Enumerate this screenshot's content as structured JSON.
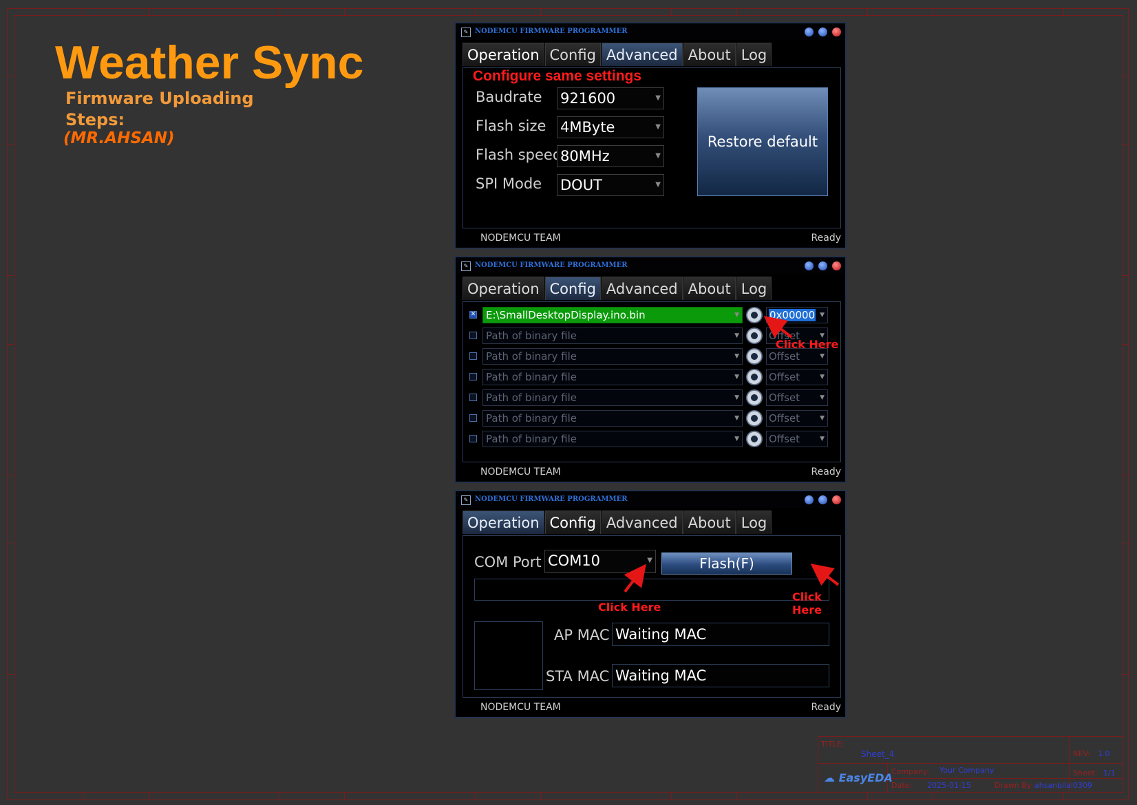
{
  "header": {
    "title": "Weather Sync",
    "subtitle_line1": "Firmware Uploading",
    "subtitle_line2": "Steps:",
    "author": "(MR.AHSAN)"
  },
  "window_title": "NODEMCU FIRMWARE PROGRAMMER",
  "tabs": [
    "Operation",
    "Config",
    "Advanced",
    "About",
    "Log"
  ],
  "status": {
    "team": "NODEMCU TEAM",
    "state": "Ready"
  },
  "advanced": {
    "note": "Configure same settings",
    "fields": [
      {
        "label": "Baudrate",
        "value": "921600"
      },
      {
        "label": "Flash size",
        "value": "4MByte"
      },
      {
        "label": "Flash speed",
        "value": "80MHz"
      },
      {
        "label": "SPI Mode",
        "value": "DOUT"
      }
    ],
    "restore_label": "Restore default"
  },
  "config": {
    "rows": [
      {
        "path": "E:\\SmallDesktopDisplay.ino.bin",
        "offset": "0x00000",
        "checked": true
      },
      {
        "path": "Path of binary file",
        "offset": "Offset",
        "checked": false
      },
      {
        "path": "Path of binary file",
        "offset": "Offset",
        "checked": false
      },
      {
        "path": "Path of binary file",
        "offset": "Offset",
        "checked": false
      },
      {
        "path": "Path of binary file",
        "offset": "Offset",
        "checked": false
      },
      {
        "path": "Path of binary file",
        "offset": "Offset",
        "checked": false
      },
      {
        "path": "Path of binary file",
        "offset": "Offset",
        "checked": false
      }
    ],
    "click_note": "Click Here"
  },
  "operation": {
    "com_label": "COM Port",
    "com_value": "COM10",
    "flash_label": "Flash(F)",
    "ap_label": "AP MAC",
    "ap_value": "Waiting MAC",
    "sta_label": "STA MAC",
    "sta_value": "Waiting MAC",
    "click_note_1": "Click Here",
    "click_note_2": "Click Here"
  },
  "titleblock": {
    "title_label": "TITLE:",
    "title_value": "Sheet_4",
    "rev_label": "REV:",
    "rev_value": "1.0",
    "company_label": "Company:",
    "company_value": "Your Company",
    "sheet_label": "Sheet:",
    "sheet_value": "1/1",
    "date_label": "Date:",
    "date_value": "2025-01-15",
    "drawn_label": "Drawn By:",
    "drawn_value": "ahsanbilal0309",
    "brand": "EasyEDA"
  },
  "colors": {
    "accent_orange": "#ff9a10",
    "note_red": "#ff1b1b",
    "tab_active": "#3c5577",
    "file_green": "#0a9a0a"
  }
}
